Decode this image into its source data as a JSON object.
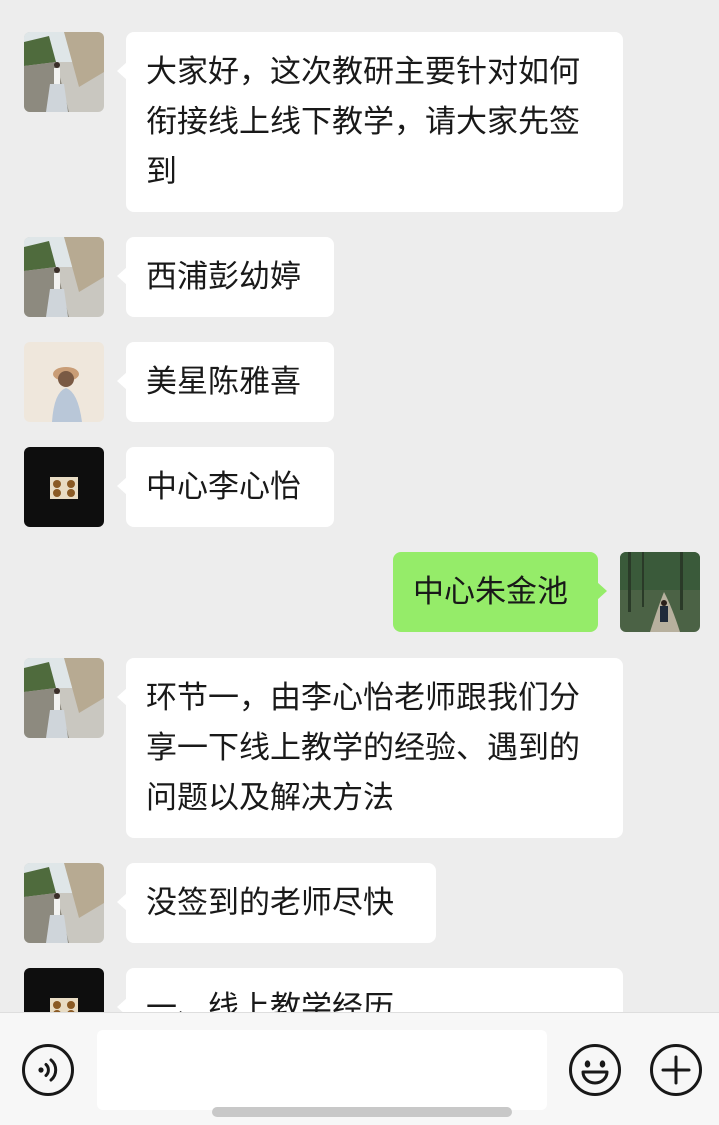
{
  "chat": {
    "messages": [
      {
        "sender": "in",
        "avatar": "landscape-avatar",
        "text": "大家好，这次教研主要针对如何衔接线上线下教学，请大家先签到"
      },
      {
        "sender": "in",
        "avatar": "landscape-avatar",
        "text": "西浦彭幼婷"
      },
      {
        "sender": "in",
        "avatar": "hat-girl-avatar",
        "text": "美星陈雅喜"
      },
      {
        "sender": "in",
        "avatar": "dark-tile-avatar",
        "text": "中心李心怡"
      },
      {
        "sender": "out",
        "avatar": "forest-path-avatar",
        "text": "中心朱金池"
      },
      {
        "sender": "in",
        "avatar": "landscape-avatar",
        "text": "环节一，由李心怡老师跟我们分享一下线上教学的经验、遇到的问题以及解决方法"
      },
      {
        "sender": "in",
        "avatar": "landscape-avatar",
        "text": "没签到的老师尽快"
      },
      {
        "sender": "in",
        "avatar": "dark-tile-avatar",
        "text": "一、线上教学经历"
      }
    ]
  },
  "input_bar": {
    "voice_icon": "voice-icon",
    "emoji_icon": "emoji-icon",
    "plus_icon": "plus-icon",
    "message_value": ""
  },
  "colors": {
    "background": "#ededed",
    "incoming_bubble": "#ffffff",
    "outgoing_bubble": "#95ec69",
    "text": "#191919"
  }
}
